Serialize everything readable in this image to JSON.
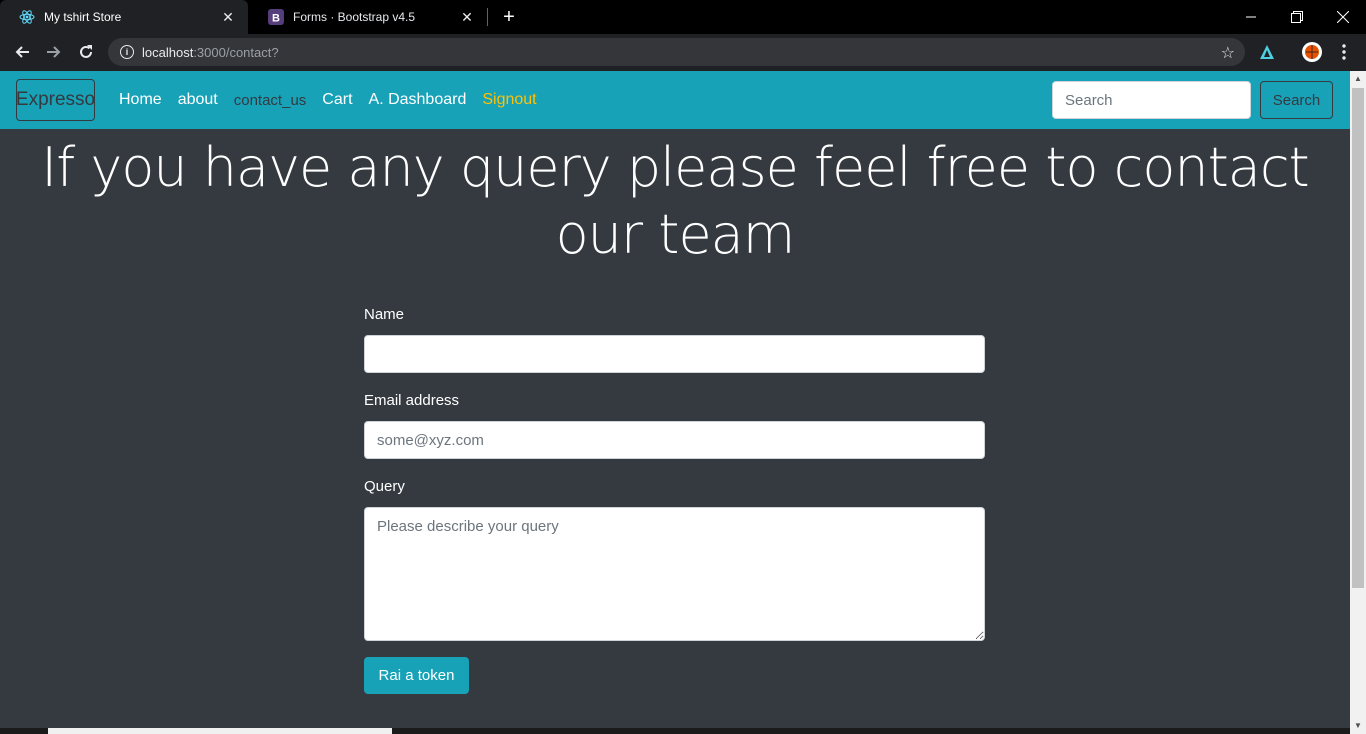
{
  "browser": {
    "tabs": [
      {
        "title": "My tshirt Store",
        "favicon": "react-icon",
        "active": true
      },
      {
        "title": "Forms · Bootstrap v4.5",
        "favicon": "bootstrap-icon",
        "active": false
      }
    ],
    "url_host": "localhost",
    "url_path": ":3000/contact?"
  },
  "navbar": {
    "brand": "Expresso",
    "links": [
      "Home",
      "about",
      "contact_us",
      "Cart",
      "A. Dashboard",
      "Signout"
    ],
    "search_placeholder": "Search",
    "search_button": "Search"
  },
  "page": {
    "heading": "If you have any query please feel free to contact our team"
  },
  "form": {
    "name_label": "Name",
    "name_value": "",
    "email_label": "Email address",
    "email_placeholder": "some@xyz.com",
    "query_label": "Query",
    "query_placeholder": "Please describe your query",
    "submit_label": "Rai a token"
  },
  "colors": {
    "accent": "#17a2b8",
    "page_bg": "#343a40",
    "signout": "#ffc107"
  }
}
